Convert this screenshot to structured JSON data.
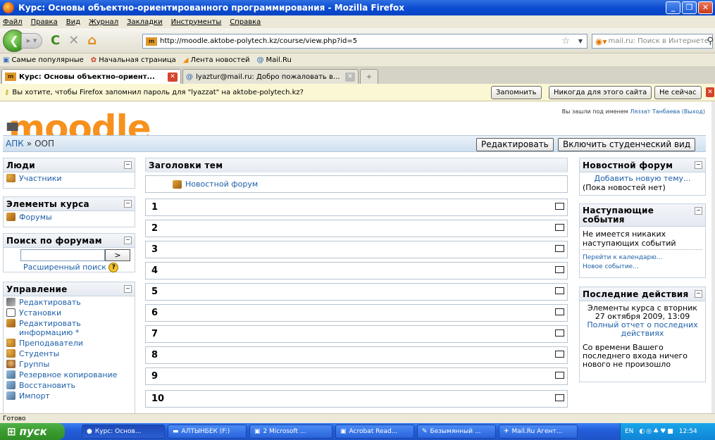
{
  "window": {
    "title": "Курс: Основы объектно-ориентированного программирования - Mozilla Firefox"
  },
  "menu": [
    "Файл",
    "Правка",
    "Вид",
    "Журнал",
    "Закладки",
    "Инструменты",
    "Справка"
  ],
  "nav": {
    "url": "http://moodle.aktobe-polytech.kz/course/view.php?id=5",
    "search_placeholder": "mail.ru: Поиск в Интернете"
  },
  "bookmarks": [
    "Самые популярные",
    "Начальная страница",
    "Лента новостей",
    "Mail.Ru"
  ],
  "tabs": [
    {
      "label": "Курс: Основы объектно-ориент..."
    },
    {
      "label": "lyaztur@mail.ru: Добро пожаловать в..."
    }
  ],
  "notification": {
    "text": "Вы хотите, чтобы Firefox запомнил пароль для \"lyazzat\" на aktobe-polytech.kz?",
    "remember": "Запомнить",
    "never": "Никогда для этого сайта",
    "not_now": "Не сейчас"
  },
  "moodle": {
    "logo": "moodle",
    "login_prefix": "Вы зашли под именем",
    "user_name": "Ляззат Танбаева",
    "logout": "(Выход)",
    "breadcrumb": {
      "root": "АПК",
      "sep": "»",
      "current": "ООП"
    },
    "edit_button": "Редактировать",
    "student_view_button": "Включить студенческий вид"
  },
  "left": {
    "people": {
      "title": "Люди",
      "items": [
        "Участники"
      ]
    },
    "activities": {
      "title": "Элементы курса",
      "items": [
        "Форумы"
      ]
    },
    "search": {
      "title": "Поиск по форумам",
      "go": ">",
      "advanced": "Расширенный поиск"
    },
    "admin": {
      "title": "Управление",
      "items": [
        "Редактировать",
        "Установки",
        "Редактировать информацию *",
        "Преподаватели",
        "Студенты",
        "Группы",
        "Резервное копирование",
        "Восстановить",
        "Импорт"
      ]
    }
  },
  "center": {
    "title": "Заголовки тем",
    "news_forum": "Новостной форум",
    "sections": [
      "1",
      "2",
      "3",
      "4",
      "5",
      "6",
      "7",
      "8",
      "9",
      "10"
    ]
  },
  "right": {
    "news": {
      "title": "Новостной форум",
      "add": "Добавить новую тему...",
      "none": "(Пока новостей нет)"
    },
    "events": {
      "title": "Наступающие события",
      "none": "Не имеется никаких наступающих событий",
      "calendar": "Перейти к календарю...",
      "new_event": "Новое событие..."
    },
    "recent": {
      "title": "Последние действия",
      "since": "Элементы курса с вторник 27 октября 2009, 13:09",
      "full_report": "Полный отчет о последних действиях",
      "nothing": "Со времени Вашего последнего входа ничего нового не произошло"
    }
  },
  "status": "Готово",
  "taskbar": {
    "start": "пуск",
    "items": [
      "Курс: Основ...",
      "АЛТЫНБЕК (F:)",
      "2 Microsoft ...",
      "Acrobat Read...",
      "Безымянный ...",
      "Mail.Ru Агент..."
    ],
    "lang": "EN",
    "clock": "12:54"
  }
}
